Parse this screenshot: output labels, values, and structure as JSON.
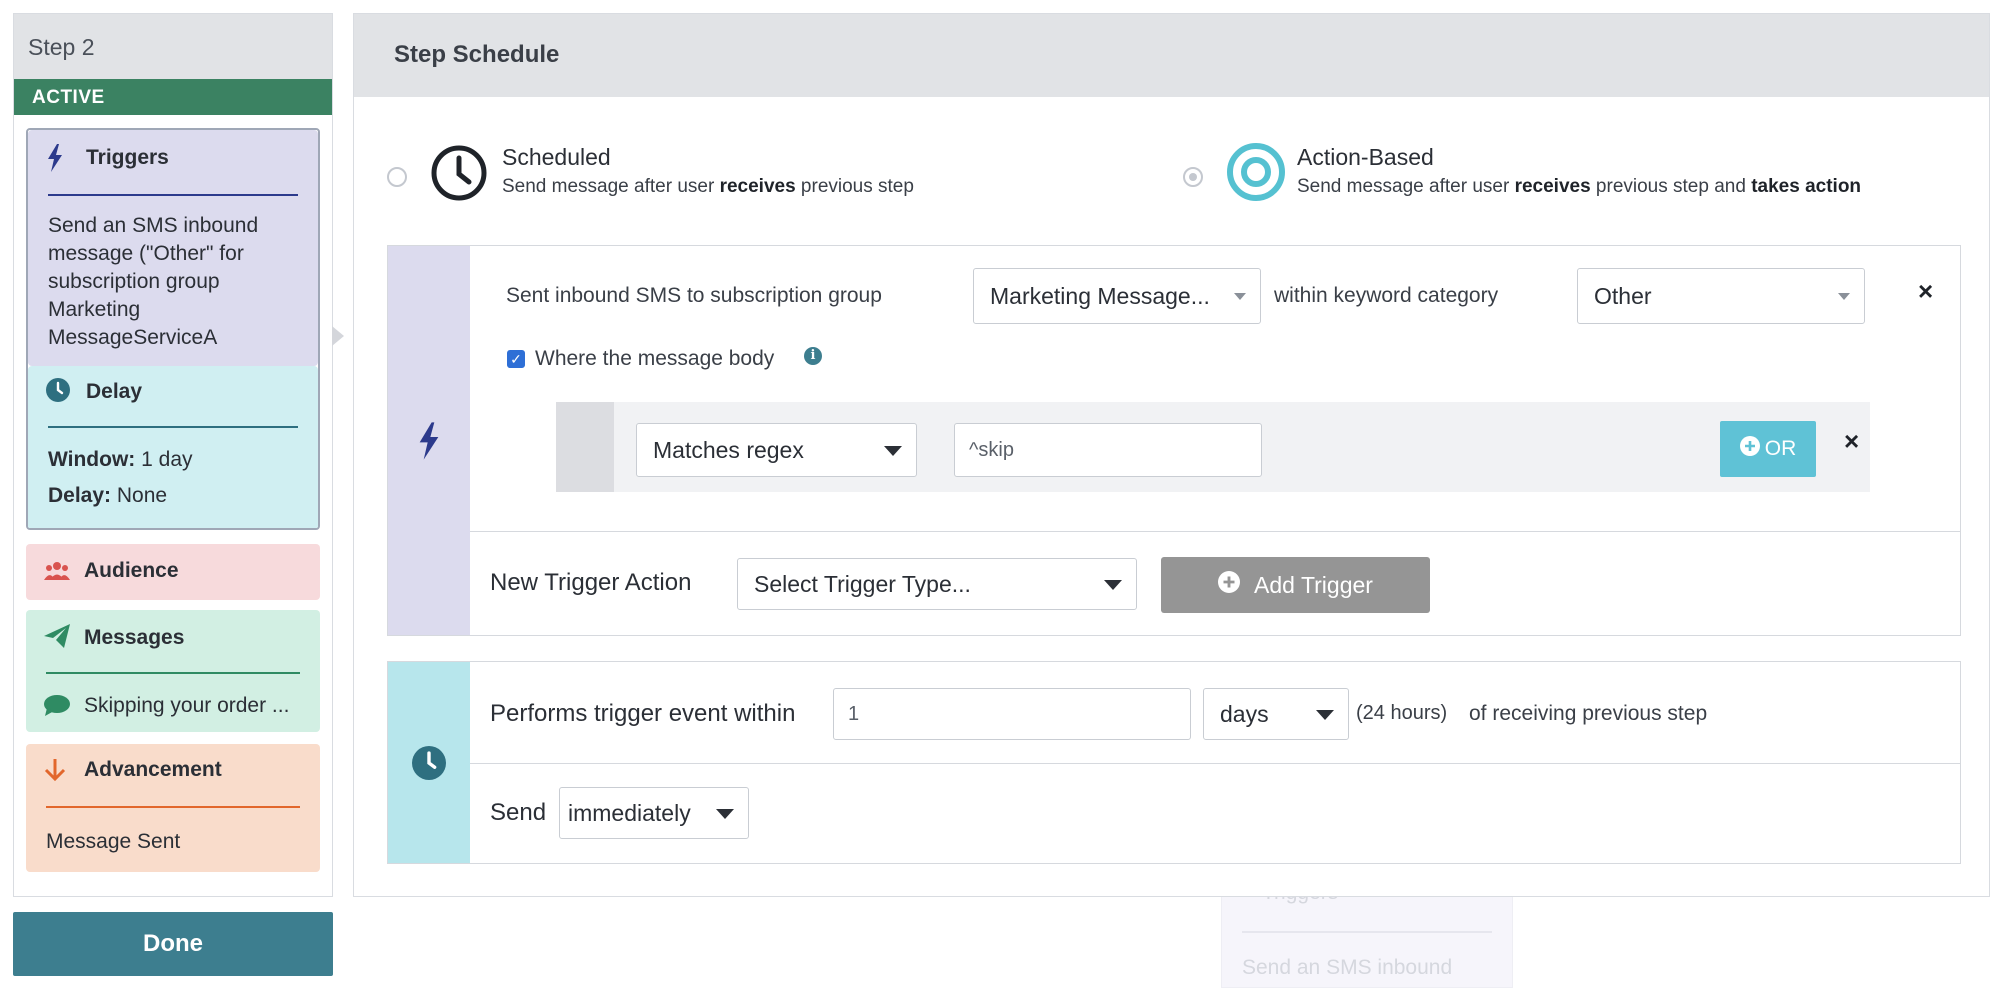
{
  "colors": {
    "active_green": "#3b8262",
    "triggers_bg": "#dcdbee",
    "delay_bg": "#d0eff2",
    "audience_bg": "#f7dadc",
    "messages_bg": "#d2efe3",
    "advancement_bg": "#f9dccb",
    "done_teal": "#3d7e8f",
    "action_based_accent": "#55c1d1",
    "or_button": "#5fc2d6",
    "add_trigger_gray": "#959595"
  },
  "step": {
    "title": "Step 2",
    "status": "ACTIVE",
    "triggers": {
      "label": "Triggers",
      "icon": "lightning-icon",
      "description": "Send an SMS inbound message (\"Other\" for subscription group Marketing MessageServiceA"
    },
    "delay": {
      "label": "Delay",
      "icon": "clock-icon",
      "window_label": "Window:",
      "window_value": "1 day",
      "delay_label": "Delay:",
      "delay_value": "None"
    },
    "audience": {
      "label": "Audience",
      "icon": "users-icon"
    },
    "messages": {
      "label": "Messages",
      "icon": "paper-plane-icon",
      "item_icon": "chat-bubble-icon",
      "item": "Skipping your order ..."
    },
    "advancement": {
      "label": "Advancement",
      "icon": "arrow-down-icon",
      "value": "Message Sent"
    }
  },
  "done_label": "Done",
  "schedule": {
    "title": "Step Schedule",
    "scheduled": {
      "label": "Scheduled",
      "desc_pre": "Send message after user ",
      "desc_bold": "receives",
      "desc_post": " previous step",
      "selected": false
    },
    "action_based": {
      "label": "Action-Based",
      "desc_pre": "Send message after user ",
      "desc_bold1": "receives",
      "desc_mid": " previous step and ",
      "desc_bold2": "takes action",
      "selected": true
    }
  },
  "trigger_rule": {
    "prefix": "Sent inbound SMS to subscription group",
    "subscription_group": "Marketing Message...",
    "keyword_text": "within keyword category",
    "keyword_category": "Other",
    "body_filter_checked": true,
    "body_filter_label": "Where the message body",
    "operator": "Matches regex",
    "pattern": "^skip",
    "or_label": "OR"
  },
  "new_trigger": {
    "label": "New Trigger Action",
    "select_placeholder": "Select Trigger Type...",
    "add_label": "Add Trigger"
  },
  "timing": {
    "performs_label": "Performs trigger event within",
    "amount": "1",
    "unit": "days",
    "hours_hint": "(24 hours)",
    "suffix": "of receiving previous step",
    "send_label": "Send",
    "send_option": "immediately"
  },
  "background": {
    "card_title": "Triggers",
    "card_text": "Send an SMS inbound message (\"Other\" for"
  }
}
